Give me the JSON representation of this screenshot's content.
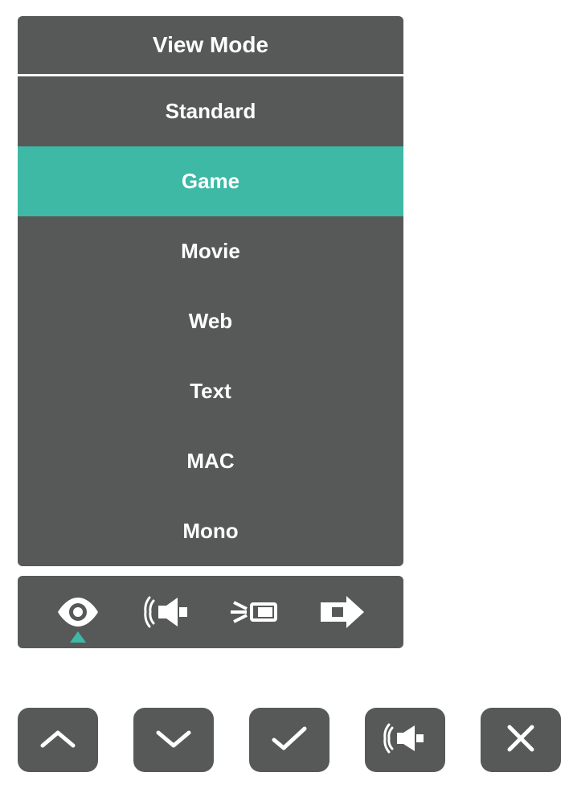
{
  "menu": {
    "title": "View Mode",
    "items": [
      {
        "label": "Standard",
        "selected": false
      },
      {
        "label": "Game",
        "selected": true
      },
      {
        "label": "Movie",
        "selected": false
      },
      {
        "label": "Web",
        "selected": false
      },
      {
        "label": "Text",
        "selected": false
      },
      {
        "label": "MAC",
        "selected": false
      },
      {
        "label": "Mono",
        "selected": false
      }
    ]
  },
  "categories": {
    "active_index": 0,
    "items": [
      {
        "name": "eye-icon"
      },
      {
        "name": "speaker-icon"
      },
      {
        "name": "projector-icon"
      },
      {
        "name": "input-source-icon"
      }
    ]
  },
  "buttons": [
    {
      "name": "up-button"
    },
    {
      "name": "down-button"
    },
    {
      "name": "confirm-button"
    },
    {
      "name": "audio-button"
    },
    {
      "name": "close-button"
    }
  ],
  "colors": {
    "panel": "#575959",
    "accent": "#3db9a6",
    "text": "#ffffff"
  }
}
